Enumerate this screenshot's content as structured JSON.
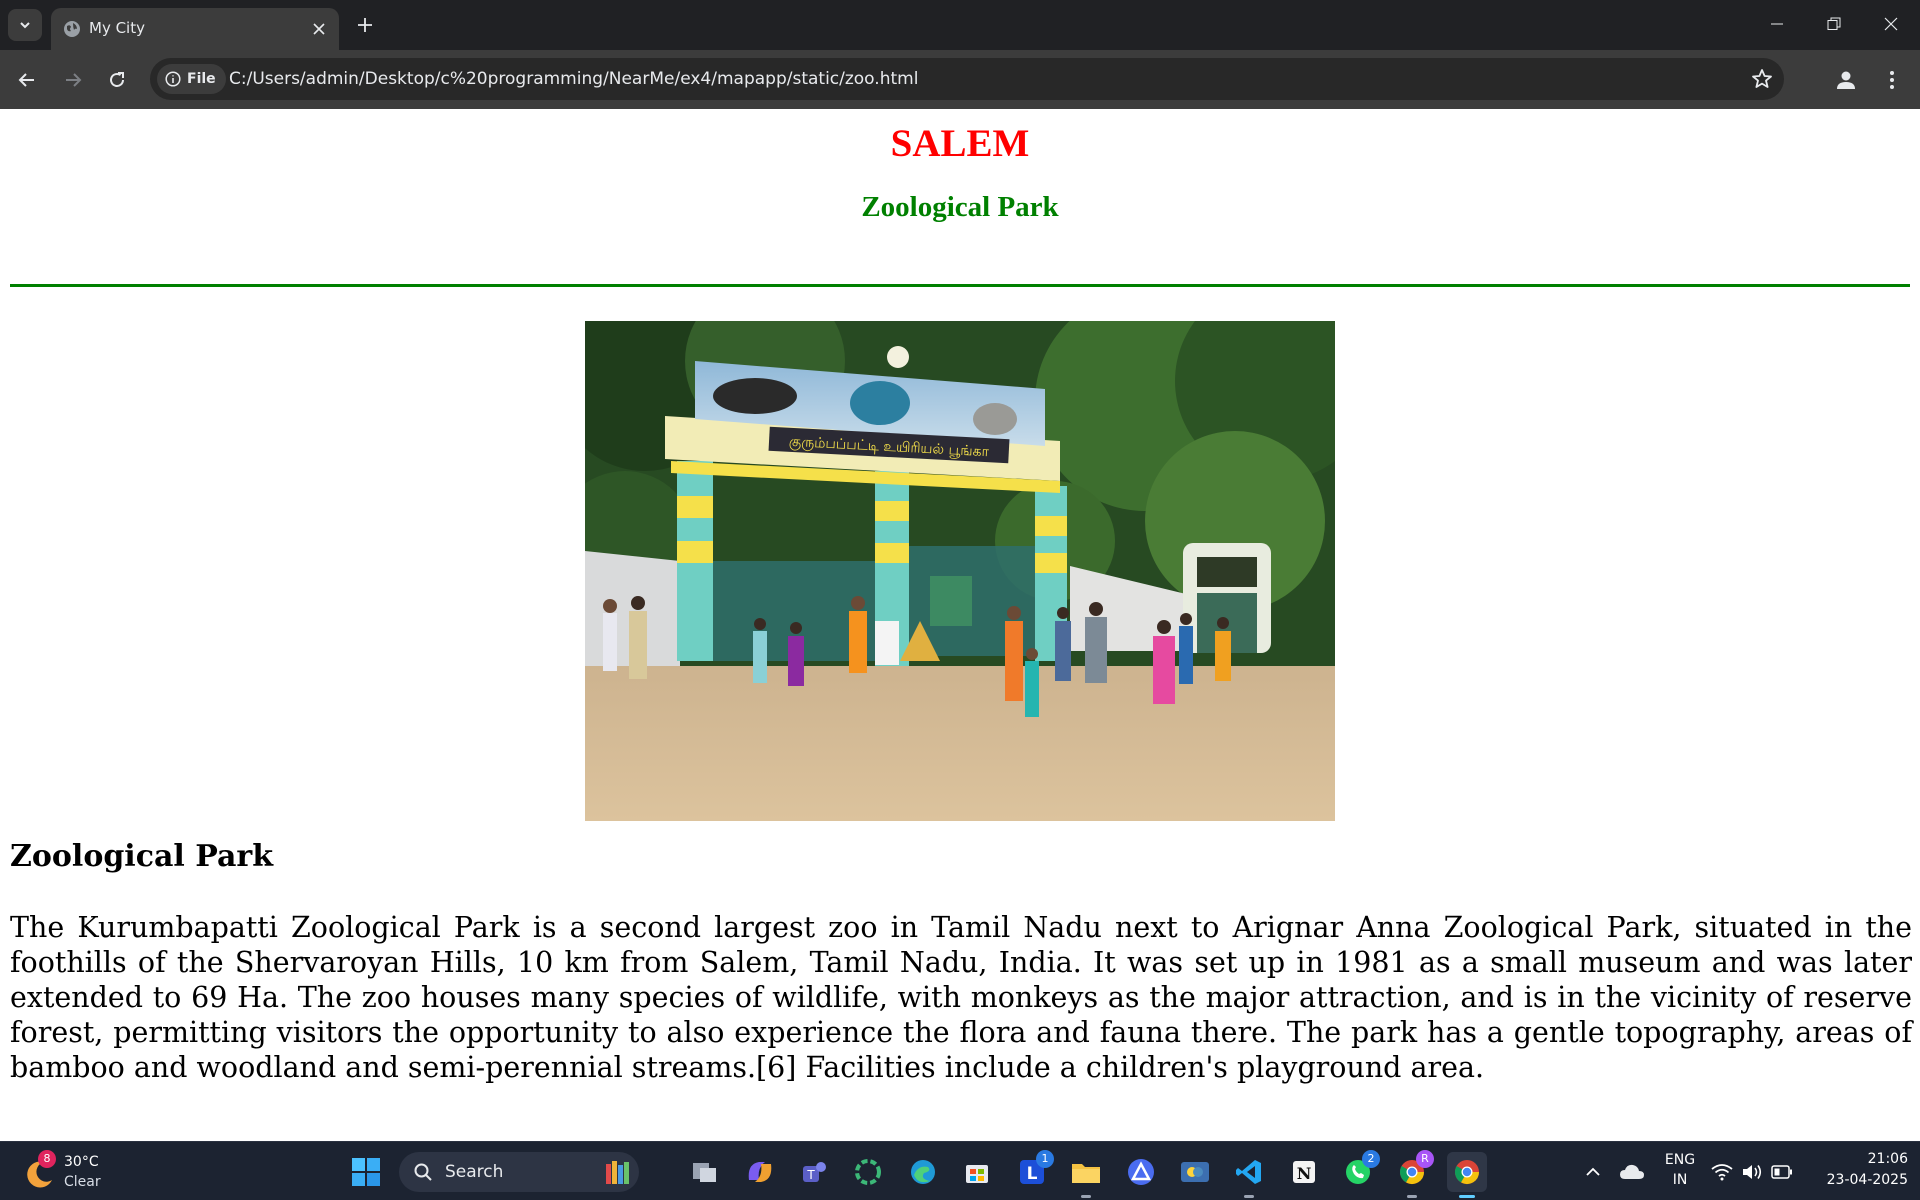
{
  "browser": {
    "tab_title": "My City",
    "url": "C:/Users/admin/Desktop/c%20programming/NearMe/ex4/mapapp/static/zoo.html",
    "site_chip": "File"
  },
  "page": {
    "city": "SALEM",
    "subtitle": "Zoological Park",
    "image_sign": "குரும்பப்பட்டி உயிரியல் பூங்கா",
    "section_heading": "Zoological Park",
    "paragraph": "The Kurumbapatti Zoological Park is a second largest zoo in Tamil Nadu next to Arignar Anna Zoological Park, situated in the foothills of the Shervaroyan Hills, 10 km from Salem, Tamil Nadu, India. It was set up in 1981 as a small museum and was later extended to 69 Ha. The zoo houses many species of wildlife, with monkeys as the major attraction, and is in the vicinity of reserve forest, permitting visitors the opportunity to also experience the flora and fauna there. The park has a gentle topography, areas of bamboo and woodland and semi-perennial streams.[6] Facilities include a children's playground area."
  },
  "taskbar": {
    "weather_temp": "30°C",
    "weather_condition": "Clear",
    "weather_badge": "8",
    "search_label": "Search",
    "apps": [
      {
        "name": "start",
        "icon": "windows-icon"
      },
      {
        "name": "task-view",
        "icon": "task-view-icon"
      },
      {
        "name": "copilot",
        "icon": "copilot-icon"
      },
      {
        "name": "teams",
        "icon": "teams-icon"
      },
      {
        "name": "app-ring",
        "icon": "ring-icon"
      },
      {
        "name": "edge",
        "icon": "edge-icon"
      },
      {
        "name": "store",
        "icon": "store-icon"
      },
      {
        "name": "l-app",
        "icon": "l-app-icon",
        "badge": "1"
      },
      {
        "name": "file-explorer",
        "icon": "folder-icon"
      },
      {
        "name": "arc-app",
        "icon": "delta-icon"
      },
      {
        "name": "python-app",
        "icon": "python-icon"
      },
      {
        "name": "vscode",
        "icon": "vscode-icon"
      },
      {
        "name": "notion",
        "icon": "notion-icon"
      },
      {
        "name": "whatsapp",
        "icon": "whatsapp-icon",
        "badge": "2"
      },
      {
        "name": "chrome-profile",
        "icon": "chrome-icon",
        "badge": "R"
      },
      {
        "name": "chrome",
        "icon": "chrome-icon"
      }
    ],
    "language_line1": "ENG",
    "language_line2": "IN",
    "time": "21:06",
    "date": "23-04-2025"
  },
  "colors": {
    "city": "#ff0000",
    "subtitle": "#008000",
    "rule": "#008000",
    "tabstrip": "#202124",
    "toolbar": "#3c3c3c",
    "taskbar": "#1c2331"
  }
}
